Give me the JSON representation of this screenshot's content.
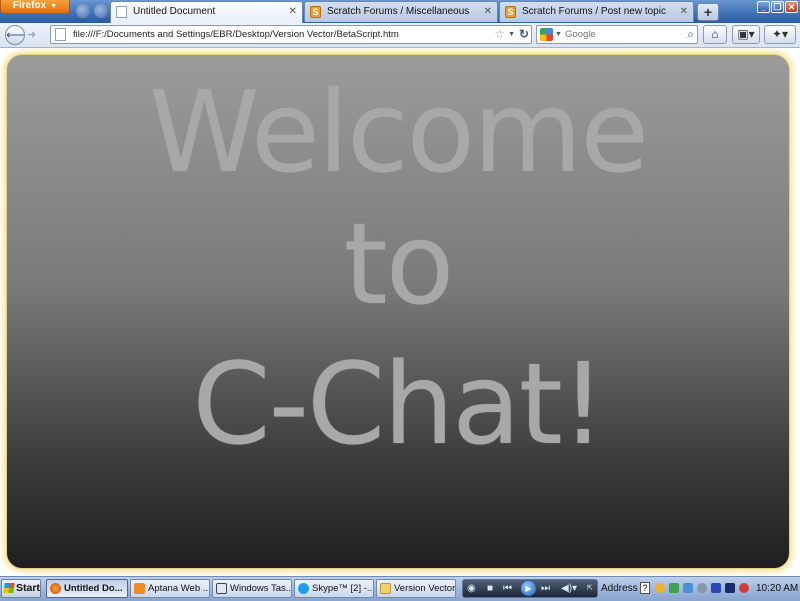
{
  "browser": {
    "app_menu_label": "Firefox",
    "tabs": [
      {
        "label": "Untitled Document",
        "active": true,
        "favicon": "page-icon"
      },
      {
        "label": "Scratch Forums / Miscellaneous",
        "active": false,
        "favicon": "scratch-icon"
      },
      {
        "label": "Scratch Forums / Post new topic",
        "active": false,
        "favicon": "scratch-icon"
      }
    ],
    "new_tab_label": "+",
    "url": "file:///F:/Documents and Settings/EBR/Desktop/Version Vector/BetaScript.htm",
    "search": {
      "engine": "Google",
      "placeholder": "Google"
    }
  },
  "page": {
    "lines": [
      "Welcome",
      "to",
      "C-Chat!"
    ],
    "text_color": "#a8a8a8",
    "panel_border_color": "#f6e5a0"
  },
  "taskbar": {
    "start_label": "Start",
    "tasks": [
      {
        "label": "Untitled Do...",
        "icon": "firefox-icon",
        "active": true
      },
      {
        "label": "Aptana Web ...",
        "icon": "aptana-icon",
        "active": false
      },
      {
        "label": "Windows Tas...",
        "icon": "task-manager-icon",
        "active": false
      },
      {
        "label": "Skype™ [2] -...",
        "icon": "skype-icon",
        "active": false
      },
      {
        "label": "Version Vector",
        "icon": "folder-icon",
        "active": false
      }
    ],
    "address_label": "Address",
    "clock": "10:20 AM"
  }
}
